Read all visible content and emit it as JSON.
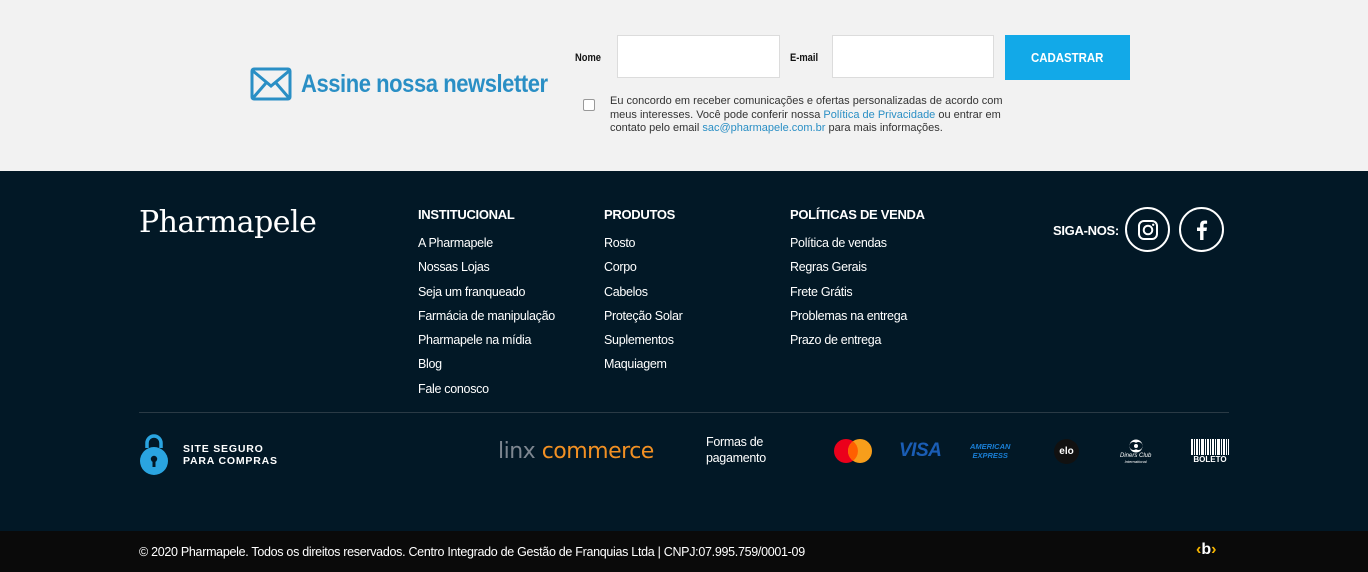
{
  "newsletter": {
    "title": "Assine nossa newsletter",
    "name_label": "Nome",
    "email_label": "E-mail",
    "name_value": "",
    "email_value": "",
    "submit_label": "CADASTRAR",
    "consent_prefix": "Eu concordo em receber comunicações e ofertas personalizadas de acordo com meus interesses. Você pode conferir nossa ",
    "privacy_link": "Política de Privacidade",
    "consent_middle": " ou entrar em contato pelo email ",
    "email_link": "sac@pharmapele.com.br",
    "consent_suffix": " para mais informações.",
    "accent_color": "#2a8fc5",
    "button_color": "#12a9e8",
    "icon": "envelope-icon"
  },
  "footer": {
    "logo": "Pharmapele",
    "columns": [
      {
        "title": "INSTITUCIONAL",
        "items": [
          "A Pharmapele",
          "Nossas Lojas",
          "Seja um franqueado",
          "Farmácia de manipulação",
          "Pharmapele na mídia",
          "Blog",
          "Fale conosco"
        ]
      },
      {
        "title": "PRODUTOS",
        "items": [
          "Rosto",
          "Corpo",
          "Cabelos",
          "Proteção Solar",
          "Suplementos",
          "Maquiagem"
        ]
      },
      {
        "title": "POLÍTICAS DE VENDA",
        "items": [
          "Política de vendas",
          "Regras Gerais",
          "Frete Grátis",
          "Problemas na entrega",
          "Prazo de entrega"
        ]
      }
    ],
    "social_label": "SIGA-NOS:",
    "social_icons": [
      "instagram-icon",
      "facebook-icon"
    ],
    "secure_line1": "SITE SEGURO",
    "secure_line2": "PARA COMPRAS",
    "linx_part1": "linx",
    "linx_part2": "commerce",
    "payment_label_1": "Formas de",
    "payment_label_2": "pagamento",
    "payment_methods": {
      "visa": "VISA",
      "amex_1": "AMERICAN",
      "amex_2": "EXPRESS",
      "elo": "elo",
      "diners_1": "Diners Club",
      "diners_2": "International",
      "boleto": "BOLETO"
    },
    "background": "#021826"
  },
  "bottom_bar": {
    "copyright": "© 2020 Pharmapele. Todos os direitos reservados. Centro Integrado de Gestão de Franquias Ltda | CNPJ:07.995.759/0001-09",
    "agency_logo": "‹b›"
  }
}
